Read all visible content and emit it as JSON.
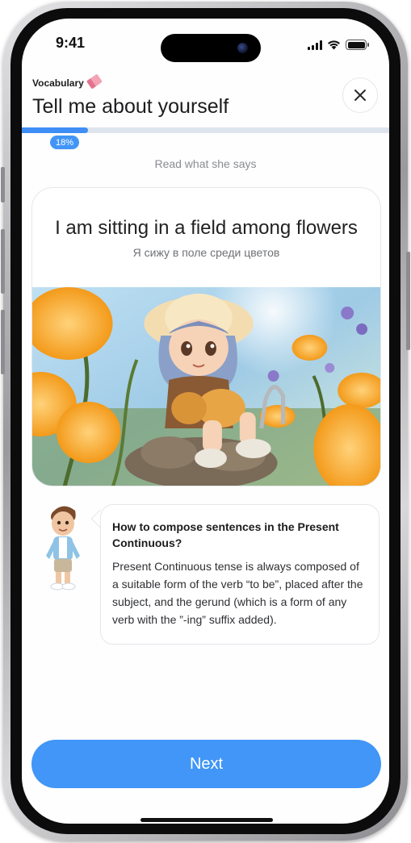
{
  "status_bar": {
    "time": "9:41"
  },
  "header": {
    "kicker": "Vocabulary",
    "title": "Tell me about yourself",
    "close_icon": "close-icon",
    "progress_fraction": 0.18,
    "progress_label": "18%"
  },
  "instruction": "Read what she says",
  "card": {
    "sentence": "I am sitting in a field among flowers",
    "translation": "Я сижу в поле среди цветов",
    "image": "girl-sitting-among-flowers"
  },
  "tip": {
    "title": "How to compose sentences in the Present Continuous?",
    "body": "Present Continuous tense is always composed of a suitable form of the verb “to be”, placed after the subject, and the gerund (which is a form of any verb with the ”-ing” suffix added)."
  },
  "footer": {
    "next_label": "Next"
  },
  "colors": {
    "accent": "#4196f7",
    "progress_track": "#dde4ee",
    "muted_text": "#8a8c91"
  }
}
